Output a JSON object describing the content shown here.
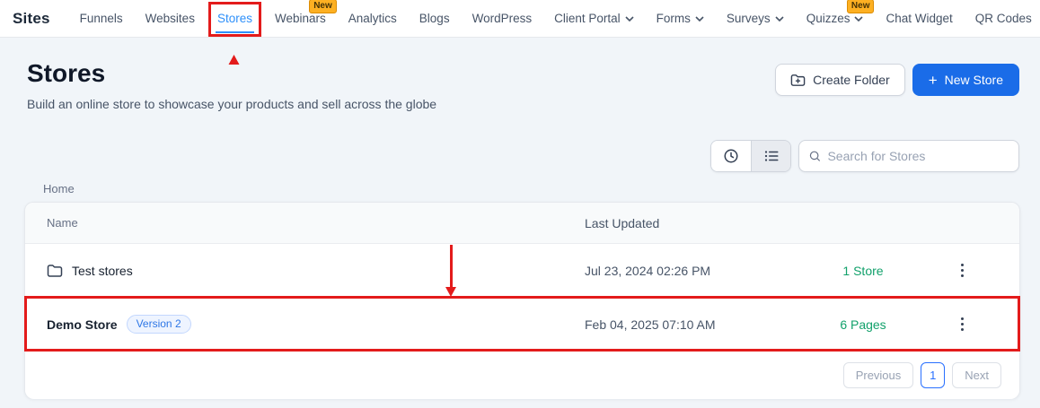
{
  "colors": {
    "accent_blue": "#1a6ce8",
    "active_tab_blue": "#2e90fa",
    "pagination_blue": "#2970ff",
    "success_green": "#12a16b",
    "annotation_red": "#e31b1b",
    "new_badge_amber": "#fdb022",
    "version_badge_bg": "#eef4ff"
  },
  "nav": {
    "brand": "Sites",
    "items": [
      {
        "label": "Funnels"
      },
      {
        "label": "Websites"
      },
      {
        "label": "Stores",
        "active": true
      },
      {
        "label": "Webinars",
        "badge": "New"
      },
      {
        "label": "Analytics"
      },
      {
        "label": "Blogs"
      },
      {
        "label": "WordPress"
      },
      {
        "label": "Client Portal",
        "caret": true
      },
      {
        "label": "Forms",
        "caret": true
      },
      {
        "label": "Surveys",
        "caret": true
      },
      {
        "label": "Quizzes",
        "caret": true,
        "badge": "New"
      },
      {
        "label": "Chat Widget"
      },
      {
        "label": "QR Codes"
      }
    ]
  },
  "header": {
    "title": "Stores",
    "subtitle": "Build an online store to showcase your products and sell across the globe",
    "create_folder_label": "Create Folder",
    "new_store_plus": "+",
    "new_store_label": "New Store"
  },
  "toolbar": {
    "search_placeholder": "Search for Stores"
  },
  "breadcrumb": {
    "label": "Home"
  },
  "table": {
    "columns": {
      "name": "Name",
      "last_updated": "Last Updated"
    },
    "rows": [
      {
        "name": "Test stores",
        "type": "folder",
        "last_updated": "Jul 23, 2024 02:26 PM",
        "count": "1 Store"
      },
      {
        "name": "Demo Store",
        "badge": "Version 2",
        "last_updated": "Feb 04, 2025 07:10 AM",
        "count": "6 Pages"
      }
    ]
  },
  "pagination": {
    "previous": "Previous",
    "page": "1",
    "next": "Next"
  }
}
